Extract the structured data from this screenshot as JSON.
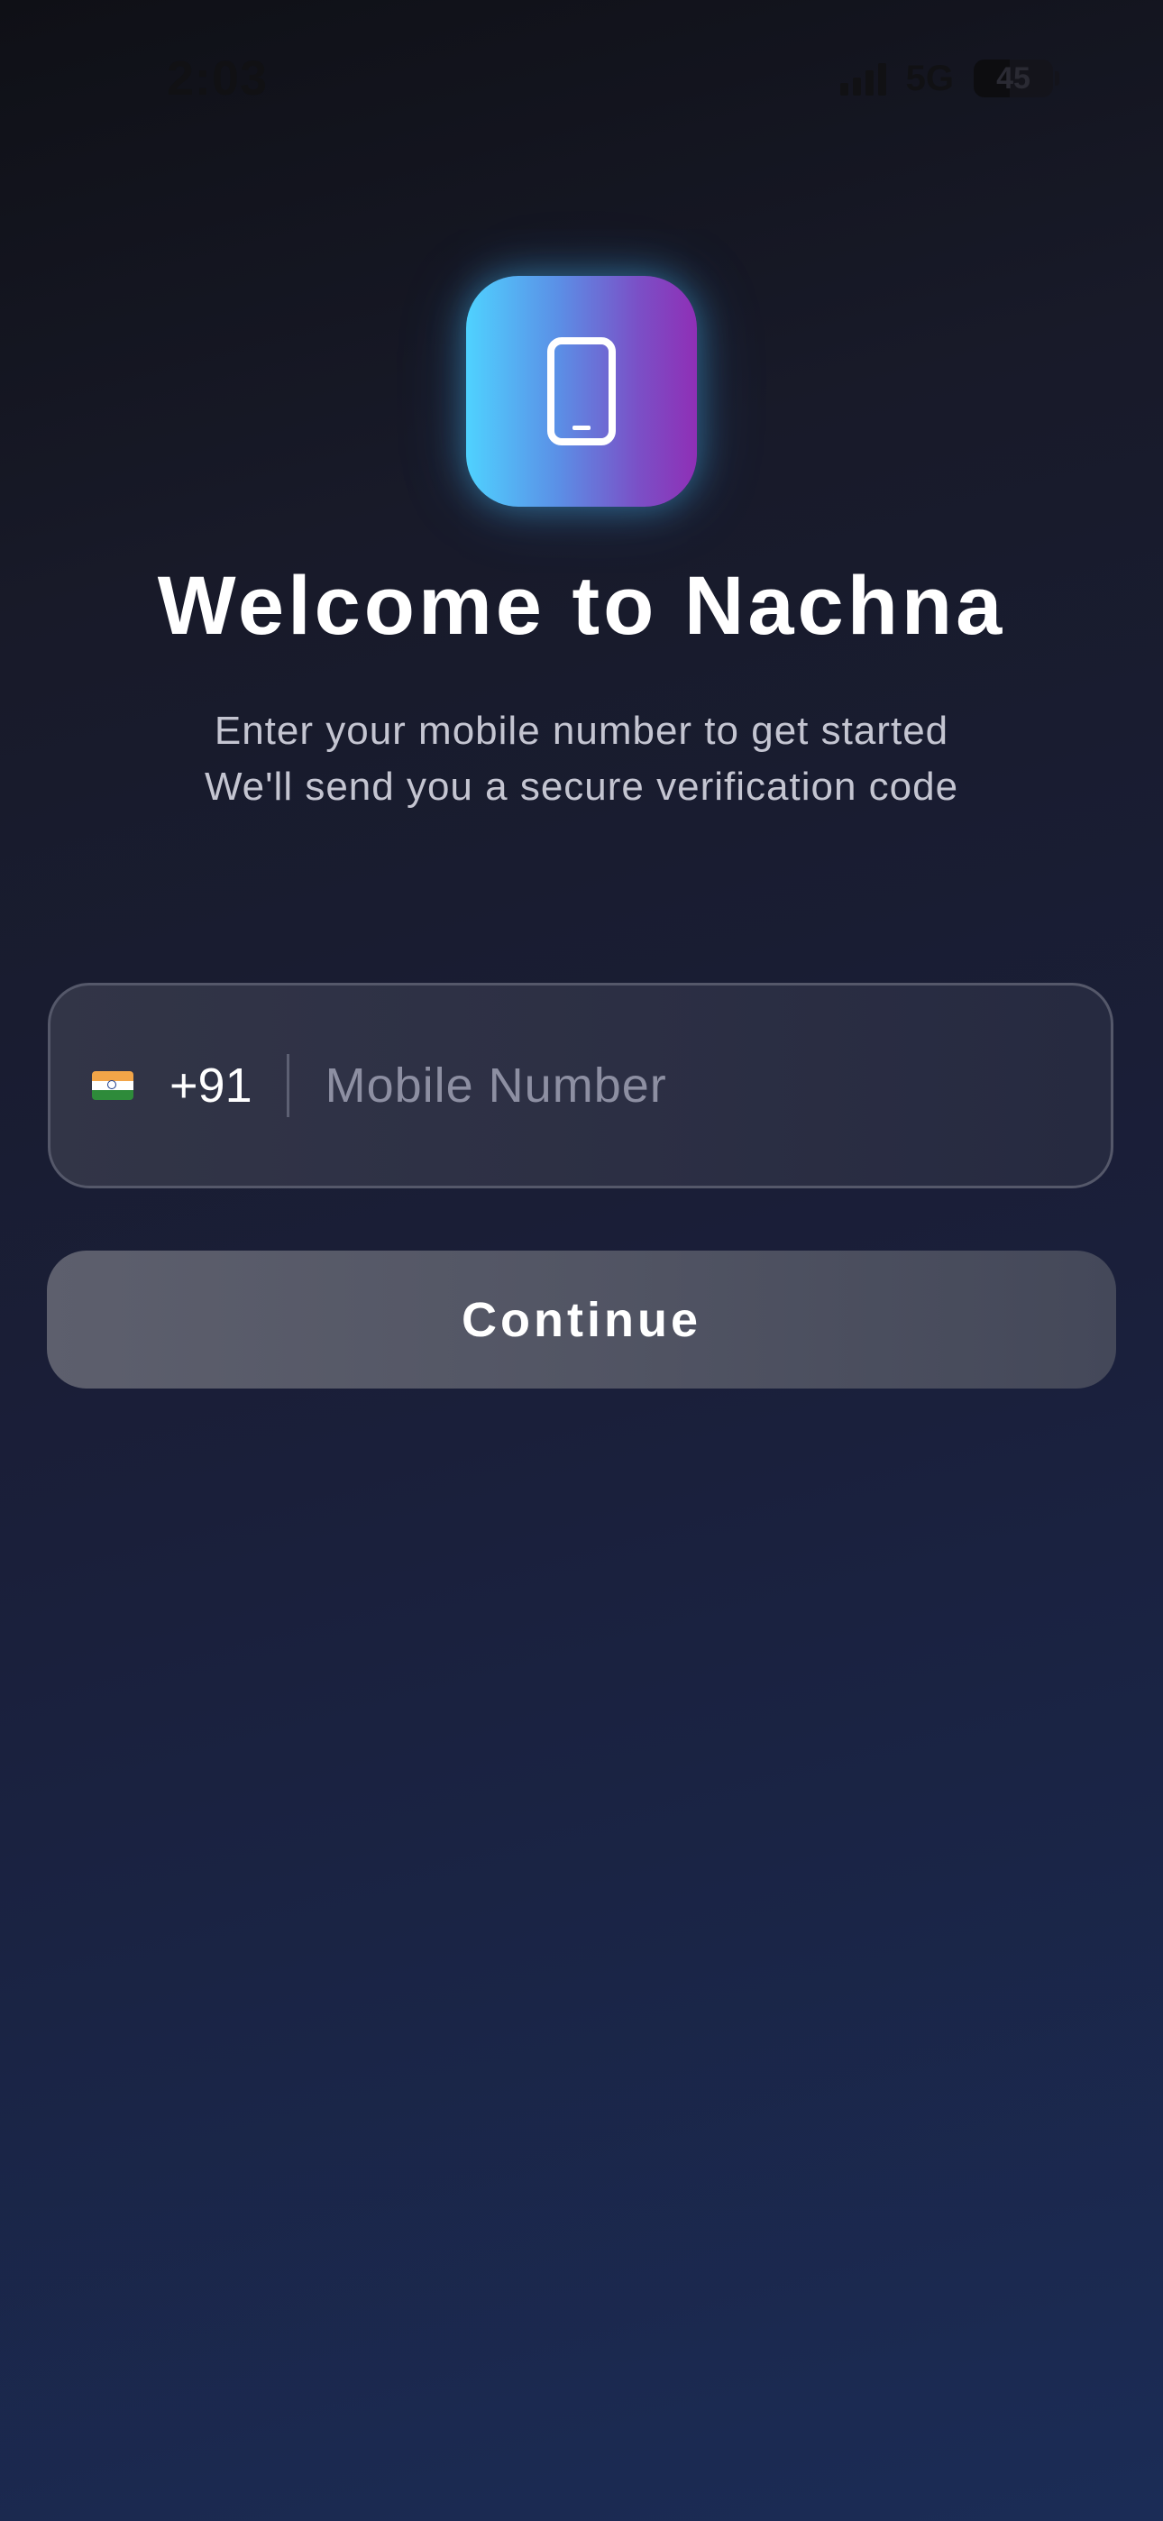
{
  "status_bar": {
    "time": "2:03",
    "network": "5G",
    "battery_level": "45",
    "battery_fraction": 0.45,
    "signal_icon": "cellular-signal-icon"
  },
  "app_icon": {
    "icon": "smartphone-icon",
    "gradient_start": "#4fd2ff",
    "gradient_end": "#8f2fb6"
  },
  "welcome": {
    "title": "Welcome to Nachna",
    "subtitle_line1": "Enter your mobile number to get started",
    "subtitle_line2": "We'll send you a secure verification code"
  },
  "phone_field": {
    "flag_icon": "india-flag-icon",
    "country_code": "+91",
    "value": "",
    "placeholder": "Mobile Number"
  },
  "continue_button": {
    "label": "Continue"
  }
}
